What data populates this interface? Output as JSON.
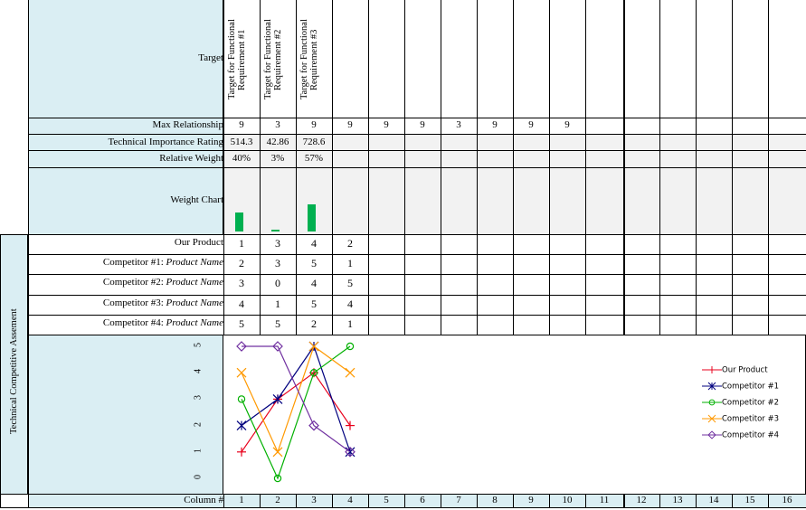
{
  "header": {
    "target_label": "Target"
  },
  "targets": [
    "Target for Functional\nRequirement #1",
    "Target for Functional\nRequirement #2",
    "Target for Functional\nRequirement #3"
  ],
  "rows": {
    "max_relationship": {
      "label": "Max Relationship",
      "values": [
        "9",
        "3",
        "9",
        "9",
        "9",
        "9",
        "3",
        "9",
        "9",
        "9"
      ]
    },
    "importance": {
      "label": "Technical Importance Rating",
      "values": [
        "514.3",
        "42.86",
        "728.6"
      ]
    },
    "relative_weight": {
      "label": "Relative Weight",
      "values": [
        "40%",
        "3%",
        "57%"
      ]
    },
    "weight_chart": {
      "label": "Weight Chart",
      "weights": [
        40,
        3,
        57
      ]
    }
  },
  "competitors": [
    {
      "label_prefix": "Our Product",
      "label_italic": "",
      "values": [
        "1",
        "3",
        "4",
        "2"
      ]
    },
    {
      "label_prefix": "Competitor #1: ",
      "label_italic": "Product Name",
      "values": [
        "2",
        "3",
        "5",
        "1"
      ]
    },
    {
      "label_prefix": "Competitor #2: ",
      "label_italic": "Product Name",
      "values": [
        "3",
        "0",
        "4",
        "5"
      ]
    },
    {
      "label_prefix": "Competitor #3: ",
      "label_italic": "Product Name",
      "values": [
        "4",
        "1",
        "5",
        "4"
      ]
    },
    {
      "label_prefix": "Competitor #4: ",
      "label_italic": "Product Name",
      "values": [
        "5",
        "5",
        "2",
        "1"
      ]
    }
  ],
  "side_label": "Technical Competitive Assement",
  "footer": {
    "label": "Column #",
    "columns": [
      "1",
      "2",
      "3",
      "4",
      "5",
      "6",
      "7",
      "8",
      "9",
      "10",
      "11",
      "12",
      "13",
      "14",
      "15",
      "16"
    ]
  },
  "chart_data": {
    "type": "line",
    "x": [
      1,
      2,
      3,
      4
    ],
    "ylim": [
      0,
      5
    ],
    "y_ticks": [
      "0",
      "1",
      "2",
      "3",
      "4",
      "5"
    ],
    "series": [
      {
        "name": "Our Product",
        "values": [
          1,
          3,
          4,
          2
        ],
        "color": "#e8001c",
        "marker": "plus"
      },
      {
        "name": "Competitor #1",
        "values": [
          2,
          3,
          5,
          1
        ],
        "color": "#00007f",
        "marker": "star"
      },
      {
        "name": "Competitor #2",
        "values": [
          3,
          0,
          4,
          5
        ],
        "color": "#00b000",
        "marker": "circle"
      },
      {
        "name": "Competitor #3",
        "values": [
          4,
          1,
          5,
          4
        ],
        "color": "#ff9900",
        "marker": "x"
      },
      {
        "name": "Competitor #4",
        "values": [
          5,
          5,
          2,
          1
        ],
        "color": "#7030a0",
        "marker": "diamond"
      }
    ]
  }
}
